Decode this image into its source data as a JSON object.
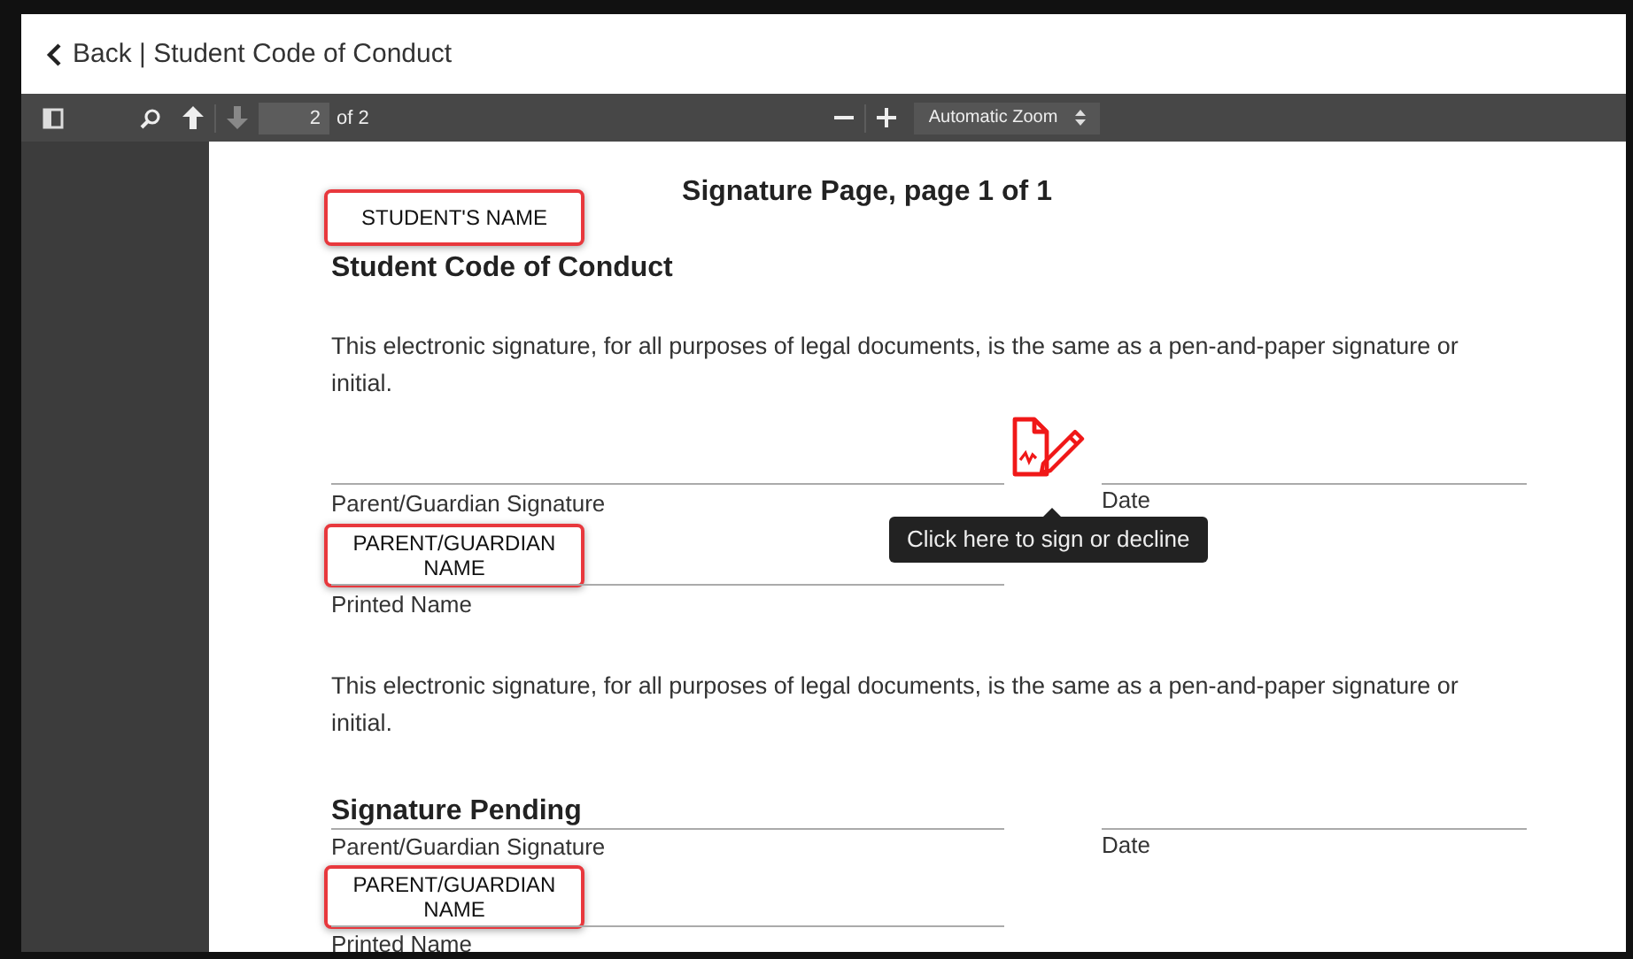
{
  "header": {
    "back_label": "Back | Student Code of Conduct"
  },
  "toolbar": {
    "page": "2",
    "page_count": "of 2",
    "previous_disabled": false,
    "next_disabled": true,
    "zoom": "Automatic Zoom"
  },
  "document": {
    "title": "Signature Page, page 1 of 1",
    "student_field": "STUDENT'S NAME",
    "heading": "Student Code of Conduct",
    "blocks": [
      {
        "kind": "paragraph",
        "text": "This electronic signature, for all purposes of legal documents, is the same as a pen-and-paper signature or initial."
      },
      {
        "kind": "signature",
        "signature_label": "Parent/Guardian Signature",
        "date_label": "Date",
        "name_field": "PARENT/GUARDIAN NAME",
        "printed_label": "Printed Name",
        "tooltip": "Click here to sign or decline"
      },
      {
        "kind": "paragraph",
        "text": "This electronic signature, for all purposes of legal documents, is the same as a pen-and-paper signature or initial."
      },
      {
        "kind": "signature",
        "status": "Signature Pending",
        "signature_label": "Parent/Guardian Signature",
        "date_label": "Date",
        "name_field": "PARENT/GUARDIAN NAME",
        "printed_label": "Printed Name"
      }
    ]
  }
}
